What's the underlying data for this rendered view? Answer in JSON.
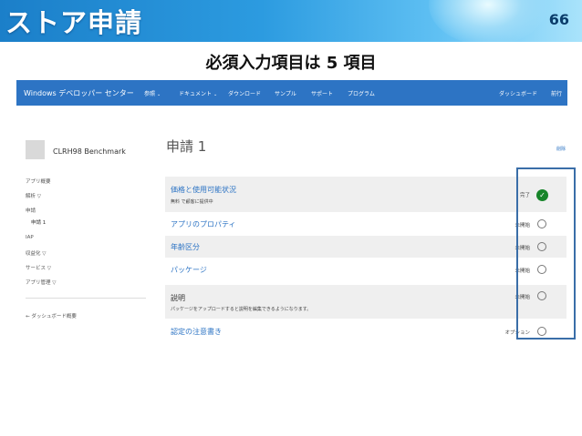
{
  "slide": {
    "title": "ストア申請",
    "number": "66",
    "subtitle": "必須入力項目は 5 項目"
  },
  "navbar": {
    "brand": "Windows デベロッパー センター",
    "items": [
      {
        "label": "参照",
        "has_dropdown": true
      },
      {
        "label": "ドキュメント",
        "has_dropdown": true
      },
      {
        "label": "ダウンロード",
        "has_dropdown": false
      },
      {
        "label": "サンプル",
        "has_dropdown": false
      },
      {
        "label": "サポート",
        "has_dropdown": false
      },
      {
        "label": "プログラム",
        "has_dropdown": false
      }
    ],
    "dashboard": "ダッシュボード",
    "user": "前行"
  },
  "sidebar": {
    "app_name": "CLRH98 Benchmark",
    "items": [
      {
        "label": "アプリ概要"
      },
      {
        "label": "解析 ▽"
      },
      {
        "label": "申請"
      },
      {
        "label": "申請 1"
      },
      {
        "label": "IAP"
      },
      {
        "label": "収益化 ▽"
      },
      {
        "label": "サービス ▽"
      },
      {
        "label": "アプリ管理 ▽"
      }
    ],
    "back_link": "← ダッシュボード概要"
  },
  "main": {
    "title": "申請 1",
    "delete": "削除",
    "rows": [
      {
        "label": "価格と使用可能状況",
        "sub": "無料 で顧客に提供中",
        "status": "完了",
        "complete": true
      },
      {
        "label": "アプリのプロパティ",
        "sub": "",
        "status": "未開始",
        "complete": false
      },
      {
        "label": "年齢区分",
        "sub": "",
        "status": "未開始",
        "complete": false
      },
      {
        "label": "パッケージ",
        "sub": "",
        "status": "未開始",
        "complete": false
      },
      {
        "label": "説明",
        "sub": "パッケージをアップロードすると説明を編集できるようになります。",
        "status": "未開始",
        "complete": false
      },
      {
        "label": "認定の注意書き",
        "sub": "",
        "status": "オプション",
        "complete": false
      }
    ]
  },
  "icons": {
    "complete": "check-circle-icon",
    "not_started": "empty-circle-icon"
  },
  "colors": {
    "nav_bar": "#2d74c4",
    "link": "#2d74c4",
    "complete": "#17852a",
    "highlight_border": "#3a6ea8"
  }
}
